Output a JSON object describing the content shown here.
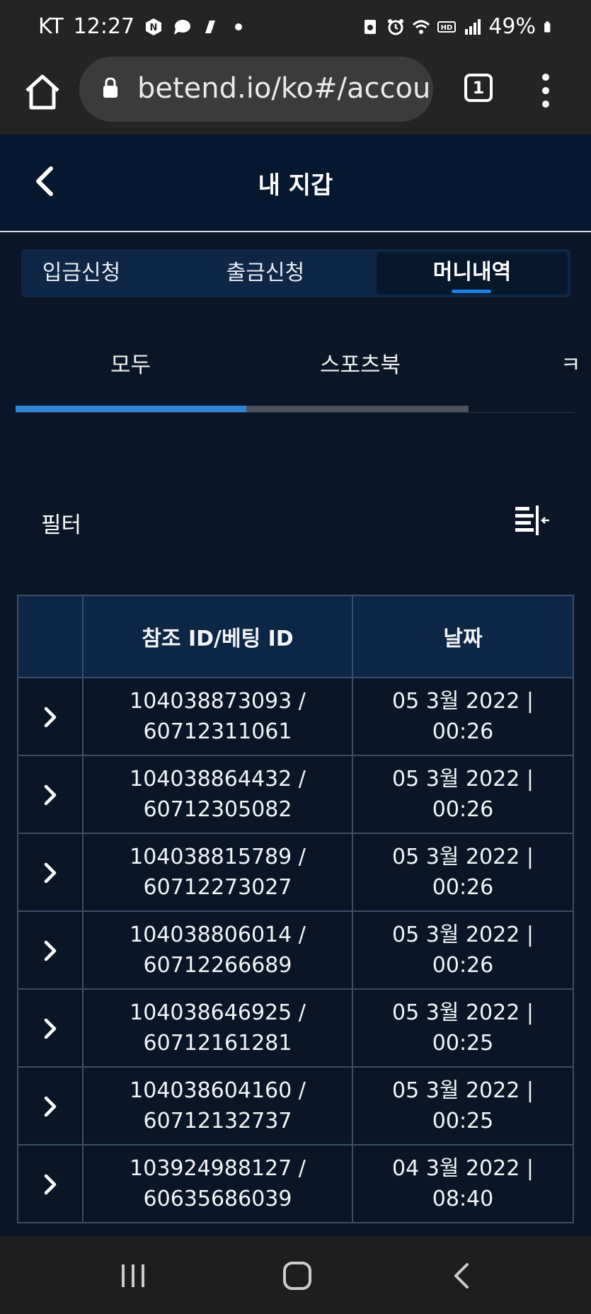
{
  "status_bar": {
    "carrier": "KT",
    "time": "12:27",
    "battery": "49%"
  },
  "browser": {
    "url": "betend.io/ko#/accour",
    "tab_count": "1"
  },
  "header": {
    "title": "내 지갑"
  },
  "main_tabs": [
    {
      "label": "입금신청",
      "active": false
    },
    {
      "label": "출금신청",
      "active": false
    },
    {
      "label": "머니내역",
      "active": true
    }
  ],
  "sub_tabs": [
    {
      "label": "모두",
      "active": true
    },
    {
      "label": "스포츠북",
      "active": false
    },
    {
      "label": "ㅋ",
      "active": false
    }
  ],
  "filter": {
    "label": "필터"
  },
  "table": {
    "headers": [
      "참조 ID/베팅 ID",
      "날짜"
    ],
    "rows": [
      {
        "id_line1": "104038873093 /",
        "id_line2": "60712311061",
        "date_line1": "05 3월 2022 |",
        "date_line2": "00:26"
      },
      {
        "id_line1": "104038864432 /",
        "id_line2": "60712305082",
        "date_line1": "05 3월 2022 |",
        "date_line2": "00:26"
      },
      {
        "id_line1": "104038815789 /",
        "id_line2": "60712273027",
        "date_line1": "05 3월 2022 |",
        "date_line2": "00:26"
      },
      {
        "id_line1": "104038806014 /",
        "id_line2": "60712266689",
        "date_line1": "05 3월 2022 |",
        "date_line2": "00:26"
      },
      {
        "id_line1": "104038646925 /",
        "id_line2": "60712161281",
        "date_line1": "05 3월 2022 |",
        "date_line2": "00:25"
      },
      {
        "id_line1": "104038604160 /",
        "id_line2": "60712132737",
        "date_line1": "05 3월 2022 |",
        "date_line2": "00:25"
      },
      {
        "id_line1": "103924988127 /",
        "id_line2": "60635686039",
        "date_line1": "04 3월 2022 |",
        "date_line2": "08:40"
      }
    ]
  },
  "colors": {
    "background": "#0a1628",
    "header_bg": "#061830",
    "accent": "#2f86d6",
    "table_border": "#3a4d66"
  }
}
